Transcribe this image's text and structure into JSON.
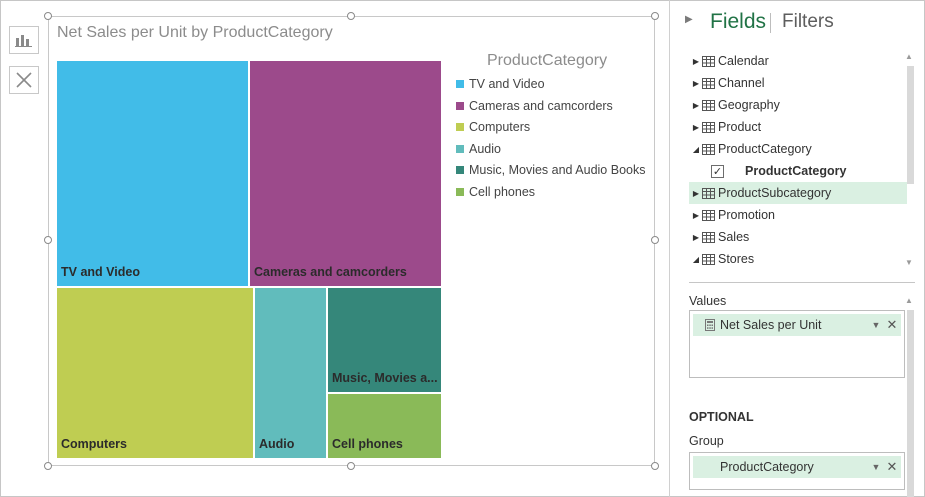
{
  "toolbar": {
    "chart_type_icon": "bar-chart-icon",
    "remove_icon": "close-icon"
  },
  "chart_data": {
    "type": "treemap",
    "title": "Net Sales per Unit by ProductCategory",
    "legend_title": "ProductCategory",
    "legend_position": "right",
    "series": [
      {
        "name": "TV and Video",
        "label": "TV and Video",
        "color": "#41bce8"
      },
      {
        "name": "Cameras and camcorders",
        "label": "Cameras and camcorders",
        "color": "#9c4a8b"
      },
      {
        "name": "Computers",
        "label": "Computers",
        "color": "#bfcd52"
      },
      {
        "name": "Audio",
        "label": "Audio",
        "color": "#61bcbc"
      },
      {
        "name": "Music, Movies and Audio Books",
        "label": "Music, Movies a...",
        "color": "#35877a"
      },
      {
        "name": "Cell phones",
        "label": "Cell phones",
        "color": "#8aba58"
      }
    ]
  },
  "fields_pane": {
    "collapse_icon": "chevron-right-icon",
    "tab_fields": "Fields",
    "tab_filters": "Filters",
    "tables": [
      {
        "name": "Calendar",
        "expanded": false,
        "selected": false
      },
      {
        "name": "Channel",
        "expanded": false,
        "selected": false
      },
      {
        "name": "Geography",
        "expanded": false,
        "selected": false
      },
      {
        "name": "Product",
        "expanded": false,
        "selected": false
      },
      {
        "name": "ProductCategory",
        "expanded": true,
        "selected": false
      },
      {
        "name": "ProductSubcategory",
        "expanded": false,
        "selected": true
      },
      {
        "name": "Promotion",
        "expanded": false,
        "selected": false
      },
      {
        "name": "Sales",
        "expanded": false,
        "selected": false
      },
      {
        "name": "Stores",
        "expanded": true,
        "selected": false
      }
    ],
    "productcategory_field": {
      "name": "ProductCategory",
      "checked": true,
      "check_glyph": "✓"
    },
    "values_label": "Values",
    "values_field": "Net Sales per Unit",
    "optional_label": "OPTIONAL",
    "group_label": "Group",
    "group_field": "ProductCategory",
    "dropdown_glyph": "▼",
    "remove_glyph": "✕"
  }
}
